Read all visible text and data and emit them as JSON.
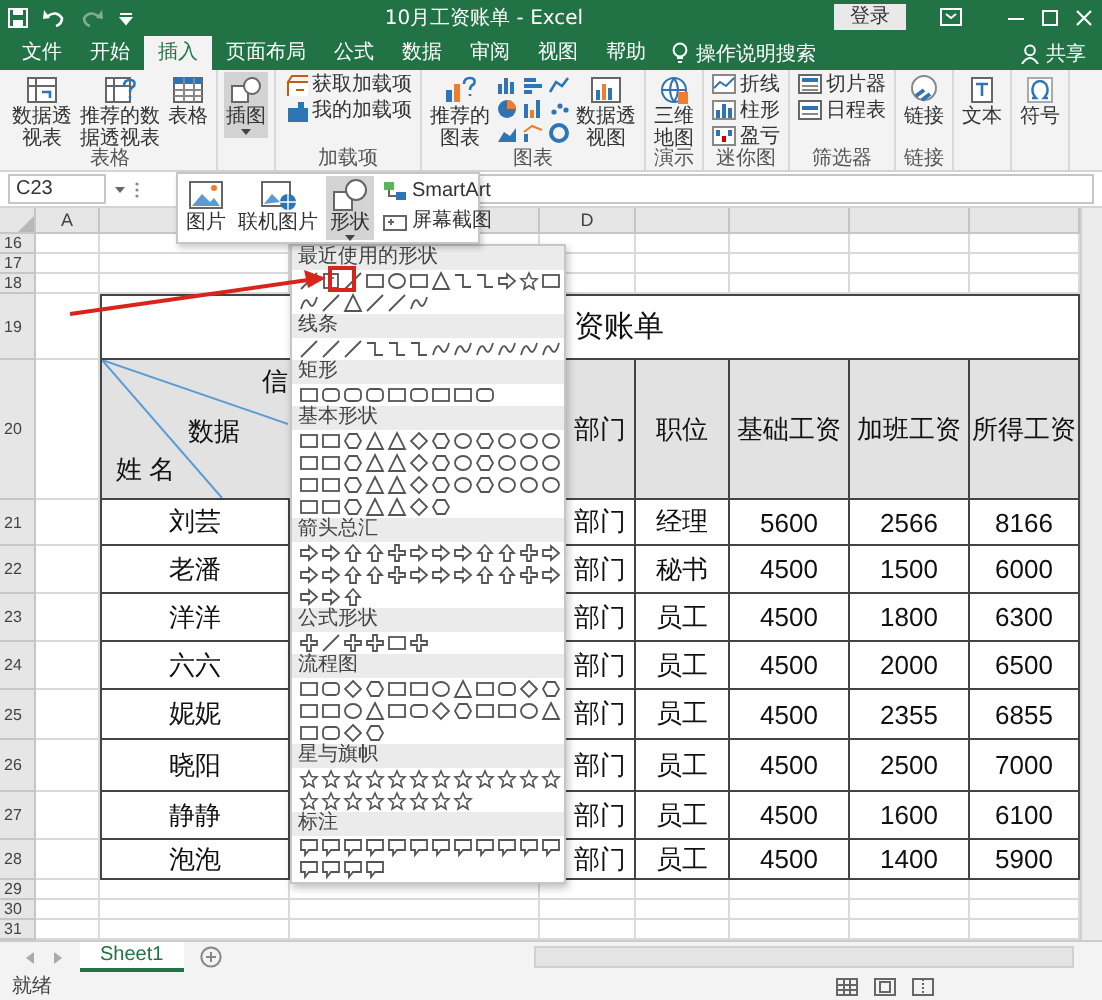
{
  "window": {
    "title": "10月工资账单 - Excel",
    "sign_in": "登录"
  },
  "tabs": [
    {
      "label": "文件",
      "selected": false
    },
    {
      "label": "开始",
      "selected": false
    },
    {
      "label": "插入",
      "selected": true
    },
    {
      "label": "页面布局",
      "selected": false
    },
    {
      "label": "公式",
      "selected": false
    },
    {
      "label": "数据",
      "selected": false
    },
    {
      "label": "审阅",
      "selected": false
    },
    {
      "label": "视图",
      "selected": false
    },
    {
      "label": "帮助",
      "selected": false
    }
  ],
  "tell_me": "操作说明搜索",
  "share": "共享",
  "ribbon": {
    "groups": [
      {
        "label": "表格",
        "buttons": [
          {
            "kind": "large",
            "label": "数据透视表"
          },
          {
            "kind": "large",
            "label": "推荐的数据透视表"
          },
          {
            "kind": "large",
            "label": "表格"
          }
        ]
      },
      {
        "buttons": [
          {
            "kind": "large",
            "label": "插图",
            "expanded": true
          }
        ]
      },
      {
        "label": "加载项",
        "buttons": [
          {
            "kind": "small",
            "label": "获取加载项"
          },
          {
            "kind": "small",
            "label": "我的加载项"
          }
        ]
      },
      {
        "label": "图表",
        "buttons": [
          {
            "kind": "large",
            "label": "推荐的图表"
          },
          {
            "kind": "gallery"
          },
          {
            "kind": "large",
            "label": "数据透视图"
          }
        ]
      },
      {
        "label": "演示",
        "buttons": [
          {
            "kind": "large",
            "label": "三维地图"
          }
        ]
      },
      {
        "label": "迷你图",
        "buttons": [
          {
            "kind": "small",
            "label": "折线"
          },
          {
            "kind": "small",
            "label": "柱形"
          },
          {
            "kind": "small",
            "label": "盈亏"
          }
        ]
      },
      {
        "label": "筛选器",
        "buttons": [
          {
            "kind": "small",
            "label": "切片器"
          },
          {
            "kind": "small",
            "label": "日程表"
          }
        ]
      },
      {
        "label": "链接",
        "buttons": [
          {
            "kind": "large",
            "label": "链接"
          }
        ]
      },
      {
        "buttons": [
          {
            "kind": "large",
            "label": "文本"
          }
        ]
      },
      {
        "buttons": [
          {
            "kind": "large",
            "label": "符号"
          }
        ]
      }
    ]
  },
  "name_box": "C23",
  "insert_menu": {
    "items": [
      {
        "kind": "large",
        "label": "图片",
        "selected": false
      },
      {
        "kind": "large",
        "label": "联机图片",
        "selected": false
      },
      {
        "kind": "large",
        "label": "形状",
        "selected": true
      },
      {
        "kind": "small",
        "label": "SmartArt",
        "selected": false
      },
      {
        "kind": "small",
        "label": "屏幕截图",
        "selected": false
      }
    ]
  },
  "shapes_gallery": {
    "sections": [
      {
        "title": "最近使用的形状"
      },
      {
        "title": "线条"
      },
      {
        "title": "矩形"
      },
      {
        "title": "基本形状"
      },
      {
        "title": "箭头总汇"
      },
      {
        "title": "公式形状"
      },
      {
        "title": "流程图"
      },
      {
        "title": "星与旗帜"
      },
      {
        "title": "标注"
      }
    ]
  },
  "sheet": {
    "column_headers": [
      "A",
      "D"
    ],
    "row_headers": [
      "16",
      "17",
      "18",
      "19",
      "20",
      "21",
      "22",
      "23",
      "24",
      "25",
      "26",
      "27",
      "28",
      "29",
      "30",
      "31"
    ],
    "title": "资账单",
    "columns": [
      {
        "kind": "diagonal",
        "labels": [
          "信",
          "数据",
          "姓 名"
        ]
      },
      {
        "kind": "text",
        "label": "部门"
      },
      {
        "kind": "text",
        "label": "职位"
      },
      {
        "kind": "text",
        "label": "基础工资"
      },
      {
        "kind": "text",
        "label": "加班工资"
      },
      {
        "kind": "text",
        "label": "所得工资"
      }
    ],
    "rows": [
      [
        "刘芸",
        "部门",
        "经理",
        "5600",
        "2566",
        "8166"
      ],
      [
        "老潘",
        "部门",
        "秘书",
        "4500",
        "1500",
        "6000"
      ],
      [
        "洋洋",
        "部门",
        "员工",
        "4500",
        "1800",
        "6300"
      ],
      [
        "六六",
        "部门",
        "员工",
        "4500",
        "2000",
        "6500"
      ],
      [
        "妮妮",
        "部门",
        "员工",
        "4500",
        "2355",
        "6855"
      ],
      [
        "晓阳",
        "部门",
        "员工",
        "4500",
        "2500",
        "7000"
      ],
      [
        "静静",
        "部门",
        "员工",
        "4500",
        "1600",
        "6100"
      ],
      [
        "泡泡",
        "部门",
        "员工",
        "4500",
        "1400",
        "5900"
      ]
    ]
  },
  "sheet_tabs": [
    {
      "label": "Sheet1",
      "selected": true
    }
  ],
  "status": "就绪"
}
